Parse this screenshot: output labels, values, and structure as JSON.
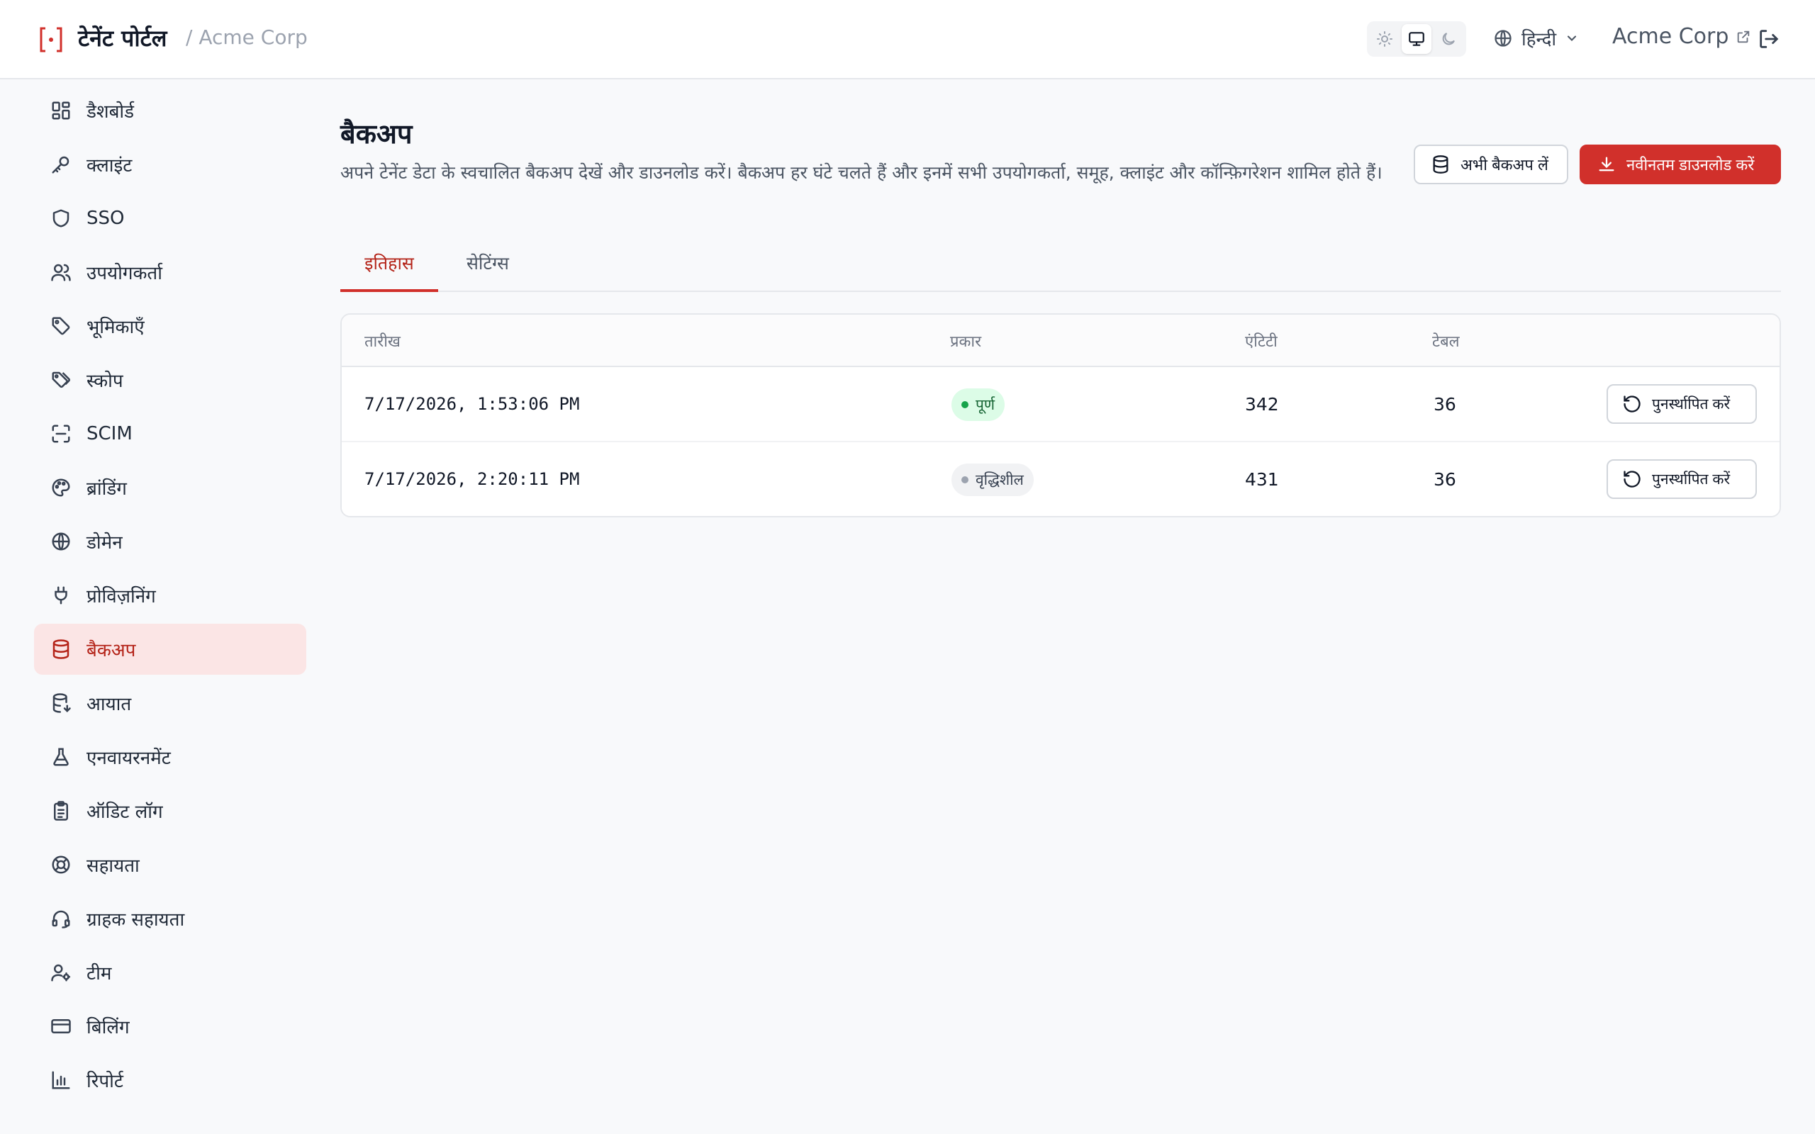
{
  "header": {
    "app_title": "टेनेंट पोर्टल",
    "breadcrumb": "/ Acme Corp",
    "language": "हिन्दी",
    "tenant_link": "Acme Corp",
    "theme_active": "system"
  },
  "sidebar": {
    "active": "backup",
    "items": [
      {
        "id": "dashboard",
        "label": "डैशबोर्ड",
        "icon": "dashboard-icon"
      },
      {
        "id": "clients",
        "label": "क्लाइंट",
        "icon": "key-icon"
      },
      {
        "id": "sso",
        "label": "SSO",
        "icon": "shield-icon"
      },
      {
        "id": "users",
        "label": "उपयोगकर्ता",
        "icon": "users-icon"
      },
      {
        "id": "roles",
        "label": "भूमिकाएँ",
        "icon": "tag-icon"
      },
      {
        "id": "scopes",
        "label": "स्कोप",
        "icon": "tags-icon"
      },
      {
        "id": "scim",
        "label": "SCIM",
        "icon": "scan-icon"
      },
      {
        "id": "branding",
        "label": "ब्रांडिंग",
        "icon": "palette-icon"
      },
      {
        "id": "domain",
        "label": "डोमेन",
        "icon": "globe-icon"
      },
      {
        "id": "provisioning",
        "label": "प्रोविज़निंग",
        "icon": "plug-icon"
      },
      {
        "id": "backup",
        "label": "बैकअप",
        "icon": "database-icon"
      },
      {
        "id": "import",
        "label": "आयात",
        "icon": "database-import-icon"
      },
      {
        "id": "environment",
        "label": "एनवायरनमेंट",
        "icon": "flask-icon"
      },
      {
        "id": "audit-log",
        "label": "ऑडिट लॉग",
        "icon": "clipboard-icon"
      },
      {
        "id": "help",
        "label": "सहायता",
        "icon": "lifebuoy-icon"
      },
      {
        "id": "customer-support",
        "label": "ग्राहक सहायता",
        "icon": "headset-icon"
      },
      {
        "id": "team",
        "label": "टीम",
        "icon": "user-cog-icon"
      },
      {
        "id": "billing",
        "label": "बिलिंग",
        "icon": "credit-card-icon"
      },
      {
        "id": "reports",
        "label": "रिपोर्ट",
        "icon": "bar-chart-icon"
      }
    ]
  },
  "page": {
    "title": "बैकअप",
    "description": "अपने टेनेंट डेटा के स्वचालित बैकअप देखें और डाउनलोड करें। बैकअप हर घंटे चलते हैं और इनमें सभी उपयोगकर्ता, समूह, क्लाइंट और कॉन्फ़िगरेशन शामिल होते हैं।",
    "backup_now_label": "अभी बैकअप लें",
    "download_latest_label": "नवीनतम डाउनलोड करें",
    "accent_color": "#d1302b"
  },
  "tabs": [
    {
      "label": "इतिहास",
      "active": true
    },
    {
      "label": "सेटिंग्स",
      "active": false
    }
  ],
  "table": {
    "columns": [
      "तारीख",
      "प्रकार",
      "एंटिटी",
      "टेबल"
    ],
    "restore_label": "पुनर्स्थापित करें",
    "rows": [
      {
        "date": "7/17/2026, 1:53:06 PM",
        "type": "पूर्ण",
        "type_kind": "complete",
        "entities": "342",
        "tables": "36"
      },
      {
        "date": "7/17/2026, 2:20:11 PM",
        "type": "वृद्धिशील",
        "type_kind": "incremental",
        "entities": "431",
        "tables": "36"
      }
    ]
  }
}
